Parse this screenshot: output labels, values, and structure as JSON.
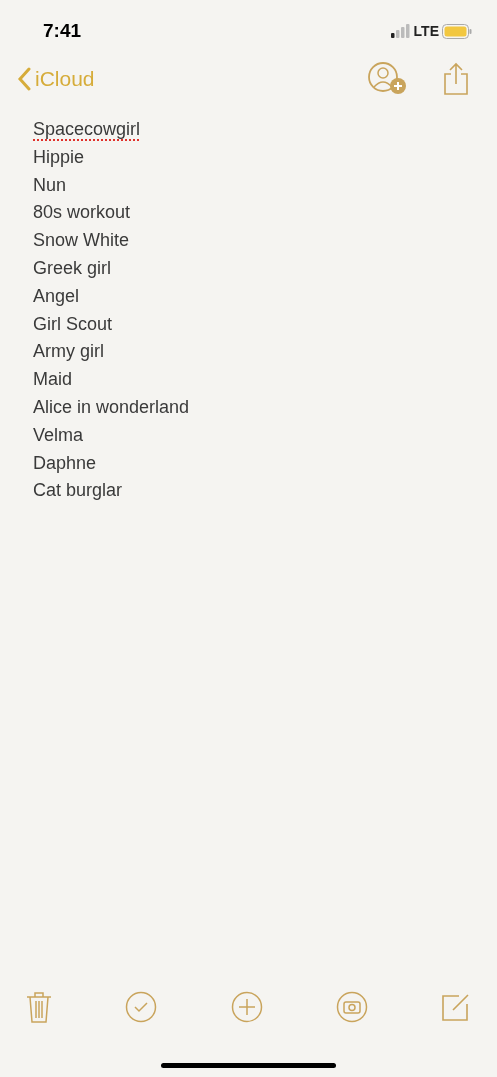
{
  "status_bar": {
    "time": "7:41",
    "network": "LTE"
  },
  "nav": {
    "back_label": "iCloud"
  },
  "note_lines": [
    {
      "text": "Spacecowgirl",
      "misspelled": true
    },
    {
      "text": "Hippie",
      "misspelled": false
    },
    {
      "text": "Nun",
      "misspelled": false
    },
    {
      "text": "80s workout",
      "misspelled": false
    },
    {
      "text": "Snow White",
      "misspelled": false
    },
    {
      "text": "Greek girl",
      "misspelled": false
    },
    {
      "text": "Angel",
      "misspelled": false
    },
    {
      "text": "Girl Scout",
      "misspelled": false
    },
    {
      "text": "Army girl",
      "misspelled": false
    },
    {
      "text": "Maid",
      "misspelled": false
    },
    {
      "text": "Alice in wonderland",
      "misspelled": false
    },
    {
      "text": "Velma",
      "misspelled": false
    },
    {
      "text": "Daphne",
      "misspelled": false
    },
    {
      "text": "Cat burglar",
      "misspelled": false
    }
  ]
}
